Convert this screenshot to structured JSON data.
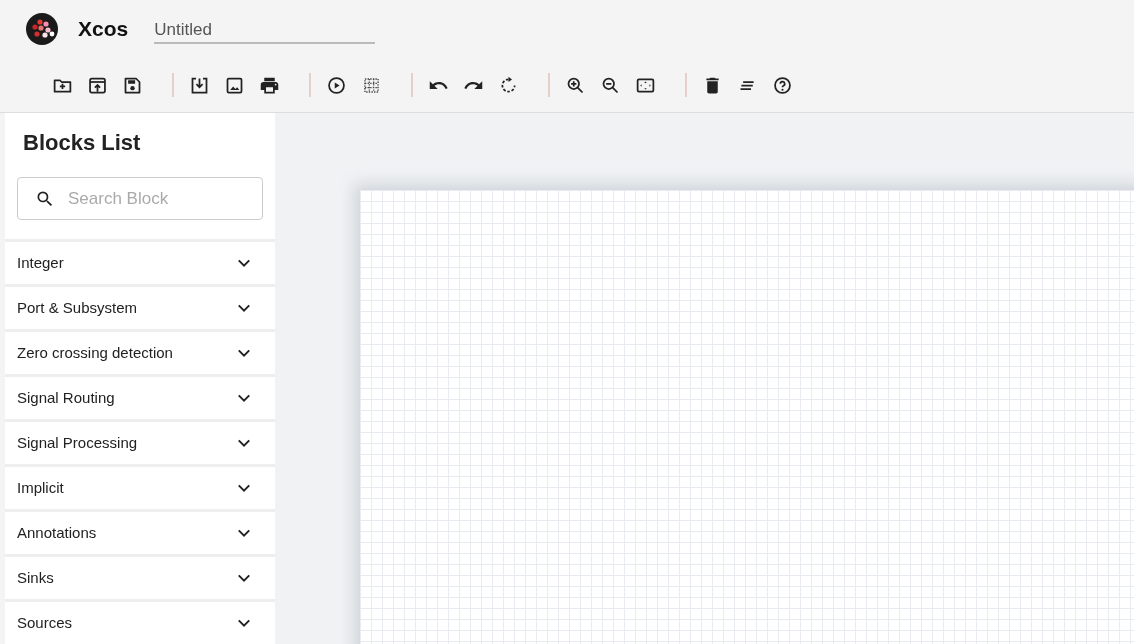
{
  "app": {
    "name": "Xcos",
    "document_title": "Untitled"
  },
  "sidebar": {
    "title": "Blocks List",
    "search": {
      "placeholder": "Search Block"
    },
    "categories": [
      {
        "label": "Integer",
        "expanded": false
      },
      {
        "label": "Port & Subsystem",
        "expanded": false
      },
      {
        "label": "Zero crossing detection",
        "expanded": false
      },
      {
        "label": "Signal Routing",
        "expanded": false
      },
      {
        "label": "Signal Processing",
        "expanded": false
      },
      {
        "label": "Implicit",
        "expanded": false
      },
      {
        "label": "Annotations",
        "expanded": false
      },
      {
        "label": "Sinks",
        "expanded": false
      },
      {
        "label": "Sources",
        "expanded": false
      }
    ]
  }
}
